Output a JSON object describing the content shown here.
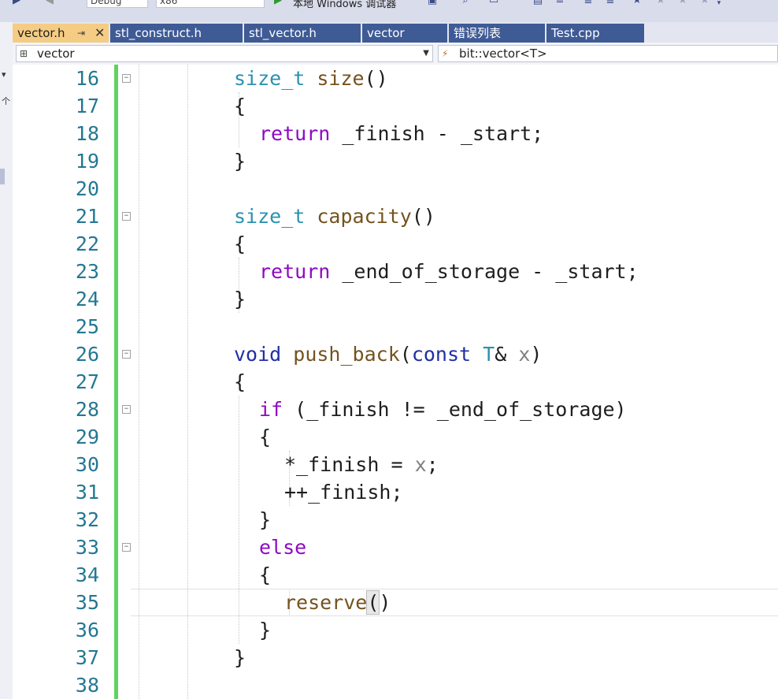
{
  "toolbar": {
    "config_combo": "Debug",
    "platform_combo": "x86",
    "run_label": "本地 Windows 调试器"
  },
  "tabs": [
    {
      "label": "vector.h",
      "active": true
    },
    {
      "label": "stl_construct.h",
      "active": false
    },
    {
      "label": "stl_vector.h",
      "active": false
    },
    {
      "label": "vector",
      "active": false
    },
    {
      "label": "错误列表",
      "active": false
    },
    {
      "label": "Test.cpp",
      "active": false
    }
  ],
  "nav": {
    "scope": "vector",
    "member": "bit::vector<T>"
  },
  "left_strip": {
    "mark": "个"
  },
  "colors": {
    "keyword": "#1f2fa6",
    "type": "#2b91af",
    "function": "#74531f",
    "control": "#8f08c4",
    "param": "#808080",
    "line_number": "#237893",
    "change_bar": "#5fd35f",
    "active_tab": "#f5cc84",
    "inactive_tab": "#3f5b96"
  },
  "editor": {
    "lines": [
      {
        "n": "16",
        "tokens": [
          [
            "type",
            "size_t"
          ],
          [
            "id",
            " "
          ],
          [
            "fn",
            "size"
          ],
          [
            "id",
            "()"
          ]
        ]
      },
      {
        "n": "17",
        "tokens": [
          [
            "id",
            "{"
          ]
        ]
      },
      {
        "n": "18",
        "tokens": [
          [
            "ctl",
            "return"
          ],
          [
            "id",
            " _finish - _start;"
          ]
        ]
      },
      {
        "n": "19",
        "tokens": [
          [
            "id",
            "}"
          ]
        ]
      },
      {
        "n": "20",
        "tokens": []
      },
      {
        "n": "21",
        "tokens": [
          [
            "type",
            "size_t"
          ],
          [
            "id",
            " "
          ],
          [
            "fn",
            "capacity"
          ],
          [
            "id",
            "()"
          ]
        ]
      },
      {
        "n": "22",
        "tokens": [
          [
            "id",
            "{"
          ]
        ]
      },
      {
        "n": "23",
        "tokens": [
          [
            "ctl",
            "return"
          ],
          [
            "id",
            " _end_of_storage - _start;"
          ]
        ]
      },
      {
        "n": "24",
        "tokens": [
          [
            "id",
            "}"
          ]
        ]
      },
      {
        "n": "25",
        "tokens": []
      },
      {
        "n": "26",
        "tokens": [
          [
            "kw",
            "void"
          ],
          [
            "id",
            " "
          ],
          [
            "fn",
            "push_back"
          ],
          [
            "id",
            "("
          ],
          [
            "kw",
            "const"
          ],
          [
            "id",
            " "
          ],
          [
            "type",
            "T"
          ],
          [
            "id",
            "& "
          ],
          [
            "param",
            "x"
          ],
          [
            "id",
            ")"
          ]
        ]
      },
      {
        "n": "27",
        "tokens": [
          [
            "id",
            "{"
          ]
        ]
      },
      {
        "n": "28",
        "tokens": [
          [
            "ctl",
            "if"
          ],
          [
            "id",
            " (_finish != _end_of_storage)"
          ]
        ]
      },
      {
        "n": "29",
        "tokens": [
          [
            "id",
            "{"
          ]
        ]
      },
      {
        "n": "30",
        "tokens": [
          [
            "id",
            "*_finish = "
          ],
          [
            "param",
            "x"
          ],
          [
            "id",
            ";"
          ]
        ]
      },
      {
        "n": "31",
        "tokens": [
          [
            "id",
            "++_finish;"
          ]
        ]
      },
      {
        "n": "32",
        "tokens": [
          [
            "id",
            "}"
          ]
        ]
      },
      {
        "n": "33",
        "tokens": [
          [
            "ctl",
            "else"
          ]
        ]
      },
      {
        "n": "34",
        "tokens": [
          [
            "id",
            "{"
          ]
        ]
      },
      {
        "n": "35",
        "tokens": [
          [
            "fn",
            "reserve"
          ],
          [
            "caret",
            "("
          ],
          [
            "id",
            ")"
          ]
        ]
      },
      {
        "n": "36",
        "tokens": [
          [
            "id",
            "}"
          ]
        ]
      },
      {
        "n": "37",
        "tokens": [
          [
            "id",
            "}"
          ]
        ]
      },
      {
        "n": "38",
        "tokens": []
      }
    ]
  }
}
